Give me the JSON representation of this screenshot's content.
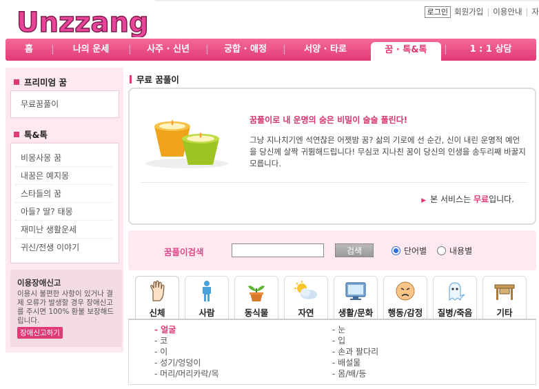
{
  "logo": {
    "text": "Unzzang"
  },
  "topnav": {
    "login": "로그인",
    "join": "회원가입",
    "guide": "이용안내",
    "more": "자"
  },
  "mainnav": [
    {
      "label": "홈"
    },
    {
      "label": "나의 운세"
    },
    {
      "label": "사주 · 신년"
    },
    {
      "label": "궁합 · 애정"
    },
    {
      "label": "서양 · 타로"
    },
    {
      "label": "꿈 · 톡&톡"
    },
    {
      "label": "1 : 1 상담"
    }
  ],
  "sidebar": {
    "premium_title": "프리미엄 꿈",
    "premium_items": [
      "무료꿈풀이"
    ],
    "talk_title": "톡&톡",
    "talk_items": [
      "비몽사몽 꿈",
      "내꿈은 예지몽",
      "스타들의 꿈",
      "아들? 딸? 태몽",
      "재미난 생활운세",
      "귀신/전생 이야기"
    ],
    "error_title": "이용장애신고",
    "error_desc": "이용시 불편한 사항이 있거나 결제 오류가 발생할 경우 장애신고를 주시면 100% 환불 보장해드립니다.",
    "error_button": "장애신고하기"
  },
  "page": {
    "title": "무료 꿈풀이"
  },
  "intro": {
    "headline": "꿈풀이로 내 운명의 숨은 비밀이 술술 풀린다!",
    "description": "그냥 지나치기엔 석연찮은 어젯밤 꿈? 삶의 기로에 선 순간, 신이 내린 운명적 예언을 당신께 살짝 귀뜀해드립니다! 무심코 지나친 꿈이 당신의 인생을 송두리째 바꿀지 모릅니다.",
    "notice_prefix": "본 서비스는 ",
    "notice_strong": "무료",
    "notice_suffix": "입니다."
  },
  "search": {
    "label": "꿈풀이검색",
    "value": "",
    "button": "검색",
    "options": [
      {
        "label": "단어별",
        "selected": true
      },
      {
        "label": "내용별",
        "selected": false
      }
    ]
  },
  "categories": [
    {
      "label": "신체",
      "icon": "hand-icon",
      "active": true
    },
    {
      "label": "사람",
      "icon": "person-icon",
      "active": false
    },
    {
      "label": "동식물",
      "icon": "sprout-icon",
      "active": false
    },
    {
      "label": "자연",
      "icon": "sun-cloud-icon",
      "active": false
    },
    {
      "label": "생활/문화",
      "icon": "tv-icon",
      "active": false
    },
    {
      "label": "행동/감정",
      "icon": "face-icon",
      "active": false
    },
    {
      "label": "질병/죽음",
      "icon": "ghost-icon",
      "active": false
    },
    {
      "label": "기타",
      "icon": "desk-icon",
      "active": false
    }
  ],
  "keywords": {
    "left": [
      "얼굴",
      "코",
      "이",
      "성기/엉덩이",
      "머리/머리카락/목"
    ],
    "right": [
      "눈",
      "입",
      "손과 팔다리",
      "배설물",
      "몸/배/등"
    ],
    "highlighted": "얼굴"
  },
  "colors": {
    "accent": "#e23a77",
    "panel": "#fde9ef"
  }
}
